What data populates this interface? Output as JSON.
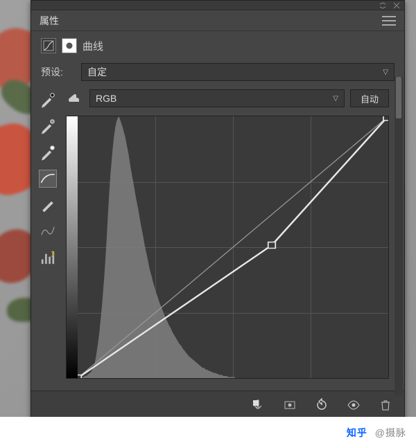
{
  "panel_title": "属性",
  "adjustment_type": "曲线",
  "preset": {
    "label": "预设:",
    "value": "自定"
  },
  "channel": {
    "value": "RGB"
  },
  "auto_label": "自动",
  "toolbar_icons": [
    "finger-icon",
    "eyedropper-black-icon",
    "eyedropper-gray-icon",
    "eyedropper-white-icon",
    "curve-smooth-icon",
    "pencil-icon",
    "smooth-curve-icon",
    "histogram-icon"
  ],
  "bottom_icons": [
    "clip-to-layer-icon",
    "view-previous-icon",
    "reset-icon",
    "visibility-icon",
    "trash-icon"
  ],
  "watermark": {
    "brand": "知乎",
    "author": "@摄脉"
  },
  "chart_data": {
    "type": "curve",
    "channel": "RGB",
    "x_range": [
      0,
      255
    ],
    "y_range": [
      0,
      255
    ],
    "control_points": [
      {
        "x": 0,
        "y": 0
      },
      {
        "x": 160,
        "y": 130
      },
      {
        "x": 255,
        "y": 255
      }
    ],
    "histogram": [
      0,
      0,
      0,
      0,
      1,
      1,
      2,
      2,
      3,
      4,
      5,
      6,
      8,
      10,
      14,
      20,
      28,
      36,
      46,
      58,
      70,
      85,
      100,
      118,
      138,
      160,
      180,
      198,
      212,
      225,
      236,
      244,
      250,
      253,
      255,
      252,
      248,
      245,
      240,
      236,
      230,
      224,
      218,
      210,
      203,
      196,
      190,
      183,
      176,
      170,
      164,
      157,
      150,
      144,
      138,
      131,
      125,
      120,
      114,
      108,
      103,
      99,
      94,
      90,
      86,
      82,
      79,
      75,
      72,
      69,
      66,
      63,
      60,
      57,
      55,
      52,
      50,
      48,
      45,
      43,
      41,
      39,
      37,
      35,
      33,
      32,
      30,
      28,
      27,
      25,
      24,
      22,
      21,
      20,
      19,
      18,
      17,
      16,
      15,
      14,
      13,
      12,
      11,
      10,
      10,
      9,
      8,
      8,
      7,
      7,
      6,
      6,
      5,
      5,
      5,
      4,
      4,
      3,
      3,
      3,
      2,
      2,
      2,
      2,
      1,
      1,
      1,
      1,
      1,
      1,
      0,
      0,
      0,
      0,
      0,
      0,
      0,
      0,
      0,
      0,
      0,
      0,
      0,
      0,
      0,
      0,
      0,
      0,
      0,
      0,
      0,
      0,
      0,
      0,
      0,
      0,
      0,
      0,
      0,
      0,
      0,
      0,
      0,
      0,
      0,
      0,
      0,
      0,
      0,
      0,
      0,
      0,
      0,
      0,
      0,
      0,
      0,
      0,
      0,
      0,
      0,
      0,
      0,
      0,
      0,
      0,
      0,
      0,
      0,
      0,
      0,
      0,
      0,
      0,
      0,
      0,
      0,
      0,
      0,
      0,
      0,
      0,
      0,
      0,
      0,
      0,
      0,
      0,
      0,
      0,
      0,
      0,
      0,
      0,
      0,
      0,
      0,
      0,
      0,
      0,
      0,
      0,
      0,
      0,
      0,
      0,
      0,
      0,
      0,
      0,
      0,
      0,
      0,
      0,
      0,
      0,
      0,
      0,
      0,
      0,
      0,
      0,
      0,
      0,
      0,
      0,
      0,
      0,
      0,
      0,
      0,
      0,
      0,
      0,
      0,
      0
    ]
  }
}
